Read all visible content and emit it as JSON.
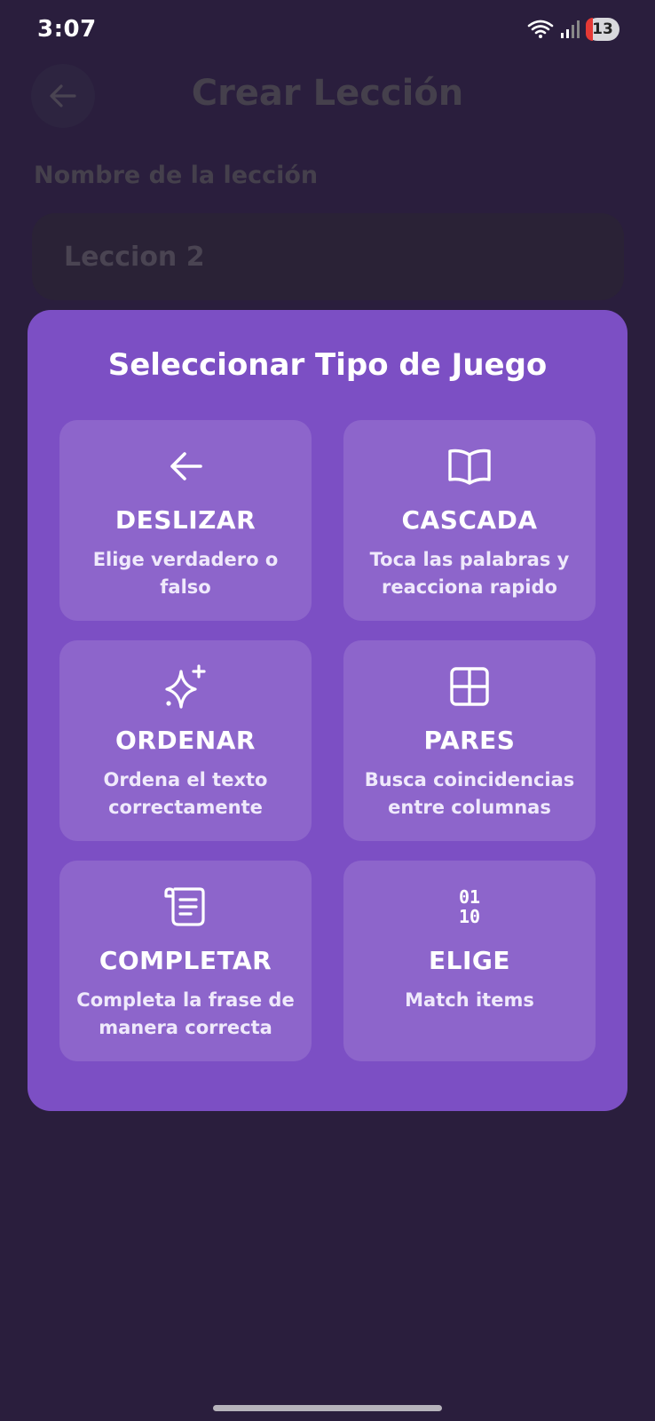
{
  "status": {
    "time": "3:07",
    "notification_count": "13"
  },
  "header": {
    "title": "Crear Lección"
  },
  "form": {
    "name_label": "Nombre de la lección",
    "name_value": "Leccion 2"
  },
  "modal": {
    "title": "Seleccionar Tipo de Juego",
    "options": [
      {
        "icon": "arrow-left-icon",
        "title": "DESLIZAR",
        "description": "Elige verdadero o falso"
      },
      {
        "icon": "book-open-icon",
        "title": "CASCADA",
        "description": "Toca las palabras y reacciona rapido"
      },
      {
        "icon": "sparkles-icon",
        "title": "ORDENAR",
        "description": "Ordena el texto correctamente"
      },
      {
        "icon": "grid-icon",
        "title": "PARES",
        "description": "Busca coincidencias entre columnas"
      },
      {
        "icon": "scroll-icon",
        "title": "COMPLETAR",
        "description": "Completa la frase de manera correcta"
      },
      {
        "icon": "binary-icon",
        "title": "ELIGE",
        "description": "Match items",
        "icon_text": [
          "01",
          "10"
        ]
      }
    ]
  },
  "colors": {
    "background": "#2a1e3d",
    "modal": "#7c4fc4",
    "card": "rgba(255,255,255,0.13)"
  }
}
